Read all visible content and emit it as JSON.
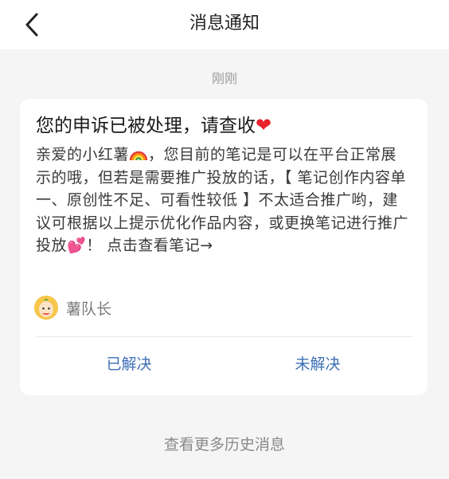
{
  "header": {
    "title": "消息通知"
  },
  "message": {
    "time": "刚刚",
    "title": "您的申诉已被处理，请查收",
    "title_emoji": "❤",
    "body_part1": "亲爱的小红薯",
    "body_part2": "，您目前的笔记是可以在平台正常展示的哦，但若是需要推广投放的话，【 笔记创作内容单一、原创性不足、可看性较低 】不太适合推广哟，建议可根据以上提示优化作品内容，或更换笔记进行推广投放",
    "body_part3": "！ 点击查看笔记→",
    "sender_name": "薯队长",
    "resolved_label": "已解决",
    "unresolved_label": "未解决"
  },
  "footer": {
    "more_label": "查看更多历史消息"
  },
  "colors": {
    "accent": "#3d6fb6",
    "heart": "#e8202c",
    "background": "#f5f5f5"
  }
}
